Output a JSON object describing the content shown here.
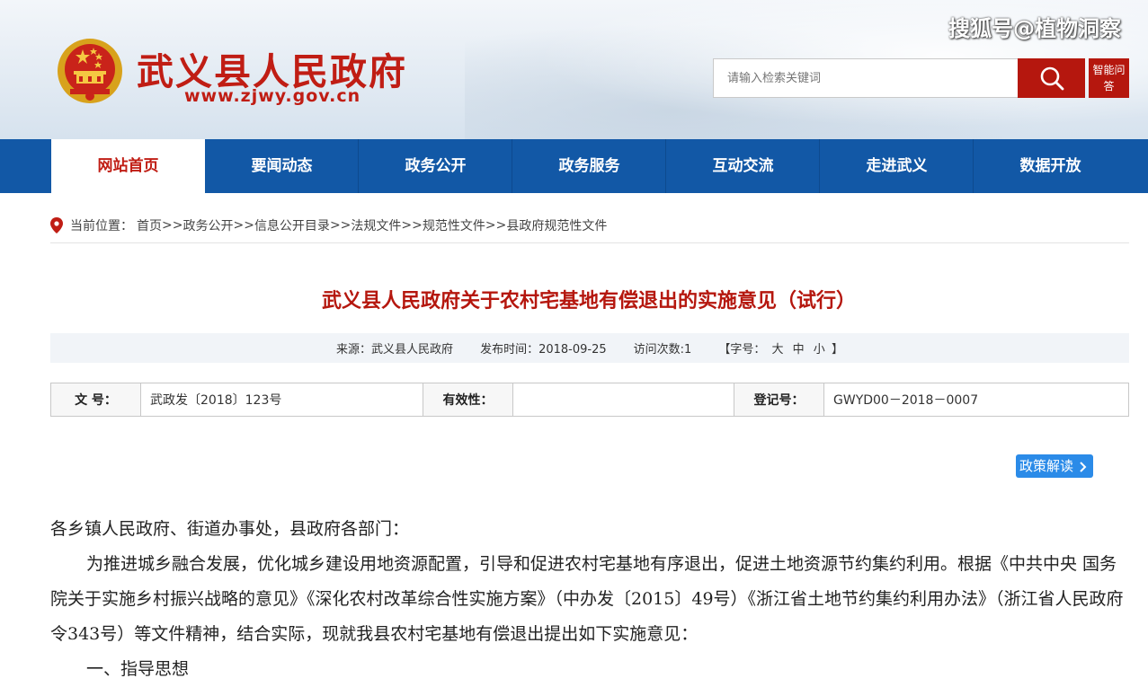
{
  "header": {
    "site_name": "武义县人民政府",
    "site_url": "www.zjwy.gov.cn",
    "watermark": "搜狐号@植物洞察",
    "search_placeholder": "请输入检索关键词",
    "ai_button": "智能问答",
    "brand_color": "#c01d14"
  },
  "nav": {
    "items": [
      {
        "label": "网站首页"
      },
      {
        "label": "要闻动态"
      },
      {
        "label": "政务公开"
      },
      {
        "label": "政务服务"
      },
      {
        "label": "互动交流"
      },
      {
        "label": "走进武义"
      },
      {
        "label": "数据开放"
      }
    ],
    "active_index": 0,
    "bar_color": "#1258a6"
  },
  "breadcrumb": {
    "prefix": "当前位置：",
    "items": [
      "首页",
      "政务公开",
      "信息公开目录",
      "法规文件",
      "规范性文件",
      "县政府规范性文件"
    ],
    "separator": " >> "
  },
  "article": {
    "title": "武义县人民政府关于农村宅基地有偿退出的实施意见（试行）",
    "meta": {
      "source_label": "来源：",
      "source_value": "武义县人民政府",
      "date_label": "发布时间：",
      "date_value": "2018-09-25",
      "visits_label": "访问次数:",
      "visits_value": "1",
      "font_size_label": "【字号：",
      "font_large": "大",
      "font_medium": "中",
      "font_small": "小",
      "font_size_end": "】"
    },
    "info_table": {
      "doc_no_label": "文 号：",
      "doc_no_value": "武政发〔2018〕123号",
      "validity_label": "有效性：",
      "validity_value": "",
      "reg_no_label": "登记号：",
      "reg_no_value": "GWYD00－2018－0007"
    },
    "policy_button": "政策解读",
    "paragraphs": [
      "各乡镇人民政府、街道办事处，县政府各部门：",
      "为推进城乡融合发展，优化城乡建设用地资源配置，引导和促进农村宅基地有序退出，促进土地资源节约集约利用。根据《中共中央 国务院关于实施乡村振兴战略的意见》《深化农村改革综合性实施方案》（中办发〔2015〕49号）《浙江省土地节约集约利用办法》（浙江省人民政府令343号）等文件精神，结合实际，现就我县农村宅基地有偿退出提出如下实施意见：",
      "一、指导思想"
    ]
  }
}
